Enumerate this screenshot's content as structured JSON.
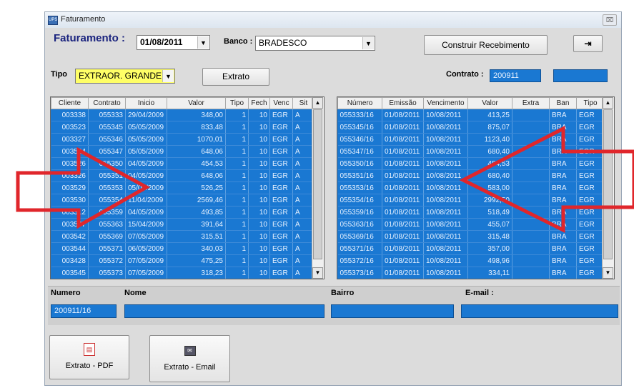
{
  "window": {
    "title": "Faturamento",
    "close_glyph": "⌧"
  },
  "header": {
    "faturamento_label": "Faturamento :",
    "date_value": "01/08/2011",
    "banco_label": "Banco :",
    "banco_value": "BRADESCO",
    "construir_label": "Construir Recebimento"
  },
  "filters": {
    "tipo_label": "Tipo",
    "tipo_value": "EXTRAOR. GRANDE",
    "extrato_label": "Extrato",
    "contrato_label": "Contrato :",
    "contrato_value": "200911",
    "contrato_extra": ""
  },
  "left_grid": {
    "columns": [
      "Cliente",
      "Contrato",
      "Inicio",
      "Valor",
      "Tipo",
      "Fech",
      "Venc",
      "Sit"
    ],
    "rows": [
      [
        "003338",
        "055333",
        "29/04/2009",
        "348,00",
        "1",
        "10",
        "EGR",
        "A"
      ],
      [
        "003523",
        "055345",
        "05/05/2009",
        "833,48",
        "1",
        "10",
        "EGR",
        "A"
      ],
      [
        "003327",
        "055346",
        "05/05/2009",
        "1070,01",
        "1",
        "10",
        "EGR",
        "A"
      ],
      [
        "003524",
        "055347",
        "05/05/2009",
        "648,06",
        "1",
        "10",
        "EGR",
        "A"
      ],
      [
        "003526",
        "055350",
        "04/05/2009",
        "454,53",
        "1",
        "10",
        "EGR",
        "A"
      ],
      [
        "003326",
        "055351",
        "04/05/2009",
        "648,06",
        "1",
        "10",
        "EGR",
        "A"
      ],
      [
        "003529",
        "055353",
        "05/04/2009",
        "526,25",
        "1",
        "10",
        "EGR",
        "A"
      ],
      [
        "003530",
        "055354",
        "11/04/2009",
        "2569,46",
        "1",
        "10",
        "EGR",
        "A"
      ],
      [
        "003312",
        "055359",
        "04/05/2009",
        "493,85",
        "1",
        "10",
        "EGR",
        "A"
      ],
      [
        "003537",
        "055363",
        "15/04/2009",
        "391,64",
        "1",
        "10",
        "EGR",
        "A"
      ],
      [
        "003542",
        "055369",
        "07/05/2009",
        "315,51",
        "1",
        "10",
        "EGR",
        "A"
      ],
      [
        "003544",
        "055371",
        "06/05/2009",
        "340,03",
        "1",
        "10",
        "EGR",
        "A"
      ],
      [
        "003428",
        "055372",
        "07/05/2009",
        "475,25",
        "1",
        "10",
        "EGR",
        "A"
      ],
      [
        "003545",
        "055373",
        "07/05/2009",
        "318,23",
        "1",
        "10",
        "EGR",
        "A"
      ]
    ]
  },
  "right_grid": {
    "columns": [
      "Número",
      "Emissão",
      "Vencimento",
      "Valor",
      "Extra",
      "Ban",
      "Tipo"
    ],
    "rows": [
      [
        "055333/16",
        "01/08/2011",
        "10/08/2011",
        "413,25",
        "",
        "BRA",
        "EGR"
      ],
      [
        "055345/16",
        "01/08/2011",
        "10/08/2011",
        "875,07",
        "",
        "BRA",
        "EGR"
      ],
      [
        "055346/16",
        "01/08/2011",
        "10/08/2011",
        "1123,40",
        "",
        "BRA",
        "EGR"
      ],
      [
        "055347/16",
        "01/08/2011",
        "10/08/2011",
        "680,40",
        "",
        "BRA",
        "EGR"
      ],
      [
        "055350/16",
        "01/08/2011",
        "10/08/2011",
        "454,53",
        "",
        "BRA",
        "EGR"
      ],
      [
        "055351/16",
        "01/08/2011",
        "10/08/2011",
        "680,40",
        "",
        "BRA",
        "EGR"
      ],
      [
        "055353/16",
        "01/08/2011",
        "10/08/2011",
        "583,00",
        "",
        "BRA",
        "EGR"
      ],
      [
        "055354/16",
        "01/08/2011",
        "10/08/2011",
        "2992,50",
        "",
        "BRA",
        "EGR"
      ],
      [
        "055359/16",
        "01/08/2011",
        "10/08/2011",
        "518,49",
        "",
        "BRA",
        "EGR"
      ],
      [
        "055363/16",
        "01/08/2011",
        "10/08/2011",
        "455,07",
        "",
        "BRA",
        "EGR"
      ],
      [
        "055369/16",
        "01/08/2011",
        "10/08/2011",
        "315,48",
        "",
        "BRA",
        "EGR"
      ],
      [
        "055371/16",
        "01/08/2011",
        "10/08/2011",
        "357,00",
        "",
        "BRA",
        "EGR"
      ],
      [
        "055372/16",
        "01/08/2011",
        "10/08/2011",
        "498,96",
        "",
        "BRA",
        "EGR"
      ],
      [
        "055373/16",
        "01/08/2011",
        "10/08/2011",
        "334,11",
        "",
        "BRA",
        "EGR"
      ]
    ]
  },
  "details": {
    "numero_label": "Numero",
    "numero_value": "200911/16",
    "nome_label": "Nome",
    "nome_value": "",
    "bairro_label": "Bairro",
    "bairro_value": "",
    "email_label": "E-mail :",
    "email_value": ""
  },
  "actions": {
    "pdf_label": "Extrato - PDF",
    "email_label": "Extrato - Email"
  },
  "colors": {
    "grid_bg": "#1a78d2",
    "tipo_bg": "#ffff66",
    "arrow": "#e0262b"
  },
  "icons": [
    "app-icon",
    "close-icon",
    "exit-door-icon",
    "pdf-icon",
    "email-icon",
    "chevron-down-icon"
  ]
}
